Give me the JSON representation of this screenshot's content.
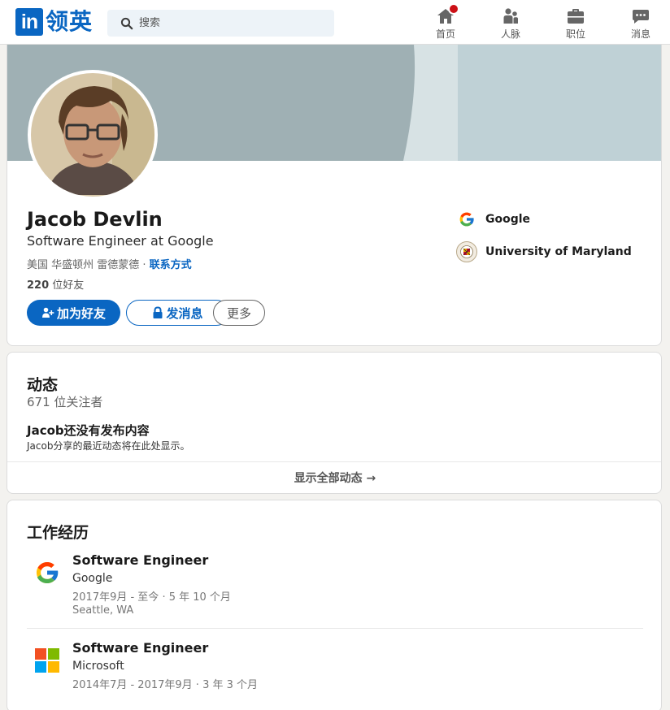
{
  "header": {
    "logo_in": "in",
    "logo_text": "领英",
    "search_placeholder": "搜索",
    "nav": [
      {
        "label": "首页",
        "icon": "home-icon"
      },
      {
        "label": "人脉",
        "icon": "people-icon"
      },
      {
        "label": "职位",
        "icon": "briefcase-icon"
      },
      {
        "label": "消息",
        "icon": "message-icon"
      }
    ]
  },
  "profile": {
    "name": "Jacob Devlin",
    "headline": "Software Engineer at Google",
    "location": "美国 华盛顿州 雷德蒙德 · ",
    "contact_link": "联系方式",
    "friends_count": "220",
    "friends_label": " 位好友",
    "buttons": {
      "connect": "加为好友",
      "message": "发消息",
      "more": "更多"
    },
    "orgs": [
      {
        "name": "Google",
        "icon": "google-logo-icon"
      },
      {
        "name": "University of Maryland",
        "icon": "umd-seal-icon"
      }
    ]
  },
  "activity": {
    "title": "动态",
    "followers": "671 位关注者",
    "empty_title": "Jacob还没有发布内容",
    "empty_subtitle": "Jacob分享的最近动态将在此处显示。",
    "show_all": "显示全部动态 →"
  },
  "experience": {
    "title": "工作经历",
    "jobs": [
      {
        "title": "Software Engineer",
        "company": "Google",
        "dates": "2017年9月 - 至今 · 5 年 10 个月",
        "location": "Seattle, WA",
        "icon": "google-logo-icon"
      },
      {
        "title": "Software Engineer",
        "company": "Microsoft",
        "dates": "2014年7月 - 2017年9月 · 3 年 3 个月",
        "location": "",
        "icon": "microsoft-logo-icon"
      }
    ]
  },
  "colors": {
    "brand": "#0a66c2",
    "badge": "#cc1016"
  }
}
